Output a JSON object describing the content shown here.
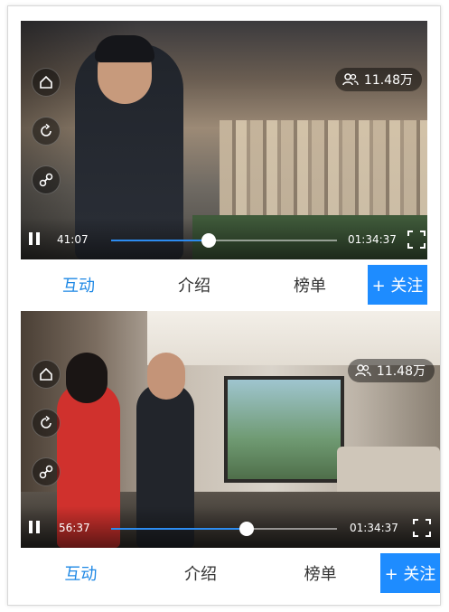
{
  "streams": [
    {
      "viewers": "11.48万",
      "current_time": "41:07",
      "duration": "01:34:37",
      "progress": 0.43,
      "tabs": [
        "互动",
        "介绍",
        "榜单"
      ],
      "active_tab": "互动",
      "follow_label": "+ 关注"
    },
    {
      "viewers": "11.48万",
      "current_time": "56:37",
      "duration": "01:34:37",
      "progress": 0.6,
      "tabs": [
        "互动",
        "介绍",
        "榜单"
      ],
      "active_tab": "互动",
      "follow_label": "+ 关注"
    }
  ],
  "colors": {
    "accent": "#1e88e5",
    "follow_bg": "#1e8cff",
    "progress": "#2d8cf0"
  },
  "icons": [
    "home-icon",
    "refresh-icon",
    "share-link-icon",
    "viewers-icon",
    "fullscreen-icon",
    "pause-icon"
  ]
}
